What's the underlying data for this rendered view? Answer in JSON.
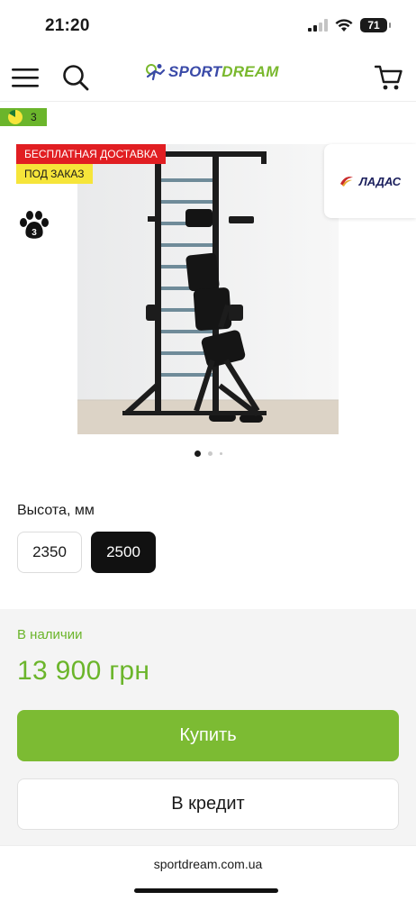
{
  "status_bar": {
    "time": "21:20",
    "battery": "71"
  },
  "header": {
    "logo_sport": "SPORT",
    "logo_dream": "DREAM",
    "menu_icon": "hamburger-menu-icon",
    "search_icon": "search-icon",
    "cart_icon": "cart-icon"
  },
  "gallery": {
    "badges": {
      "free_delivery": "БЕСПЛАТНАЯ ДОСТАВКА",
      "on_order": "ПОД ЗАКАЗ",
      "points": "3",
      "paw_level": "3"
    },
    "brand": "ЛАДАС",
    "dots": {
      "count": 3,
      "active": 1
    }
  },
  "options": {
    "label": "Высота, мм",
    "values": [
      "2350",
      "2500"
    ],
    "selected": "2500"
  },
  "buy": {
    "stock": "В наличии",
    "price": "13 900 грн",
    "buy_label": "Купить",
    "credit_label": "В кредит"
  },
  "browser": {
    "url": "sportdream.com.ua"
  },
  "colors": {
    "accent_green": "#7cbb33",
    "price_green": "#6bb52b",
    "badge_red": "#e11e22",
    "badge_yellow": "#f6e53a",
    "logo_blue": "#3a4aa8",
    "selected_option": "#111111"
  }
}
